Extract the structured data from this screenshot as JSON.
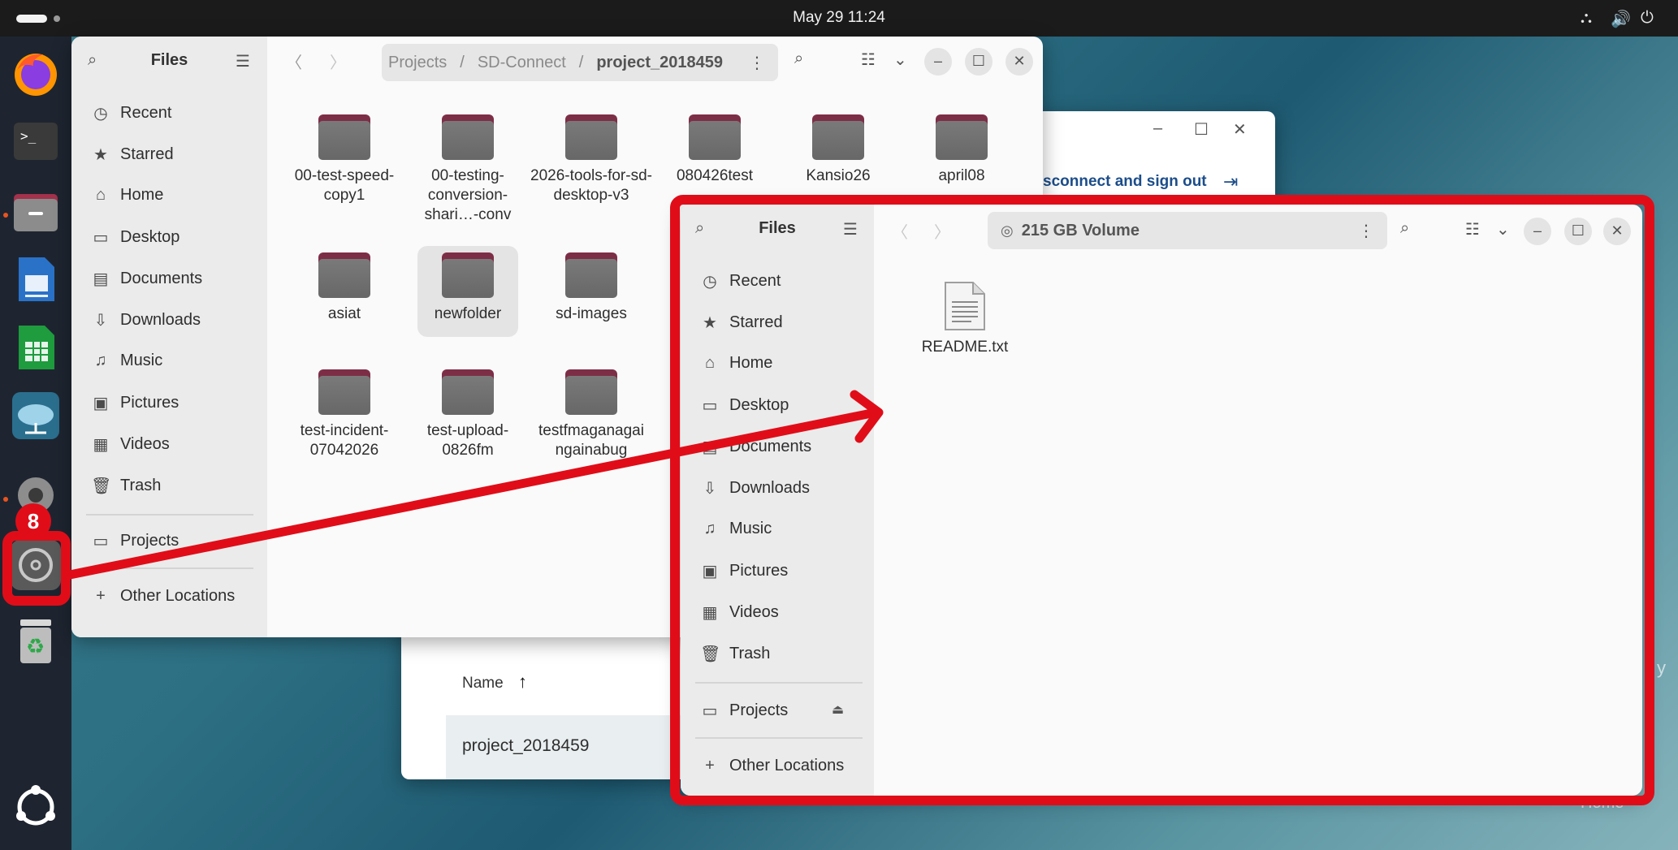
{
  "topbar": {
    "datetime": "May 29  11:24"
  },
  "dock": {
    "badge": "8"
  },
  "back_window": {
    "signout_text": "sconnect and sign out",
    "list_header": "Name",
    "list_row": "project_2018459",
    "right_edge_text": "y",
    "bottom_edge_text": "Home"
  },
  "files_window_1": {
    "sidebar_title": "Files",
    "sidebar_items": [
      "Recent",
      "Starred",
      "Home",
      "Desktop",
      "Documents",
      "Downloads",
      "Music",
      "Pictures",
      "Videos",
      "Trash"
    ],
    "mount": "Projects",
    "other_locations": "Other Locations",
    "path": [
      "Projects",
      "SD-Connect",
      "project_2018459"
    ],
    "path_sep": "/",
    "folders": [
      "00-test-speed-copy1",
      "00-testing-conversion-shari…-conv",
      "2026-tools-for-sd-desktop-v3",
      "080426test",
      "Kansio26",
      "april08",
      "asiat",
      "newfolder",
      "sd-images",
      "test-incident-07042026",
      "test-upload-0826fm",
      "testfmaganagaingainabug"
    ]
  },
  "files_window_2": {
    "sidebar_title": "Files",
    "sidebar_items": [
      "Recent",
      "Starred",
      "Home",
      "Desktop",
      "Documents",
      "Downloads",
      "Music",
      "Pictures",
      "Videos",
      "Trash"
    ],
    "mount": "Projects",
    "other_locations": "Other Locations",
    "location": "215 GB Volume",
    "file": "README.txt"
  },
  "colors": {
    "highlight": "#e00d19",
    "folder_tab": "#7d2e47",
    "dock_bg": "#1e2530"
  }
}
